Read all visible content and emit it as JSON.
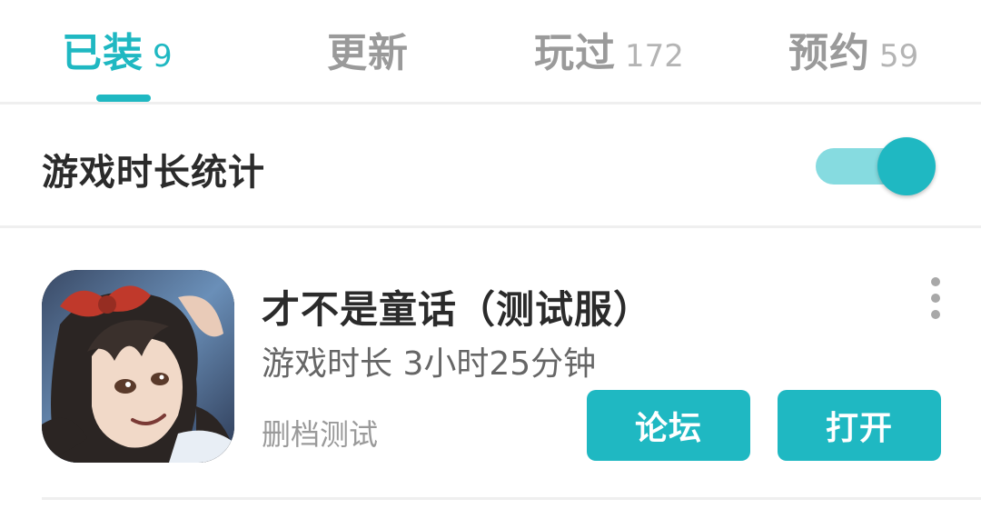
{
  "tabs": [
    {
      "label": "已装",
      "count": "9",
      "active": true
    },
    {
      "label": "更新",
      "count": "",
      "active": false
    },
    {
      "label": "玩过",
      "count": "172",
      "active": false
    },
    {
      "label": "预约",
      "count": "59",
      "active": false
    }
  ],
  "stats": {
    "title": "游戏时长统计",
    "toggle_on": true
  },
  "game": {
    "name": "才不是童话（测试服）",
    "play_time": "游戏时长 3小时25分钟",
    "tag": "删档测试",
    "icon": "game-avatar-girl-with-red-bow",
    "buttons": {
      "forum": "论坛",
      "open": "打开"
    }
  },
  "colors": {
    "accent": "#1fb8c2",
    "accent_light": "#86dbe0",
    "tab_inactive": "#9a9a9a"
  }
}
